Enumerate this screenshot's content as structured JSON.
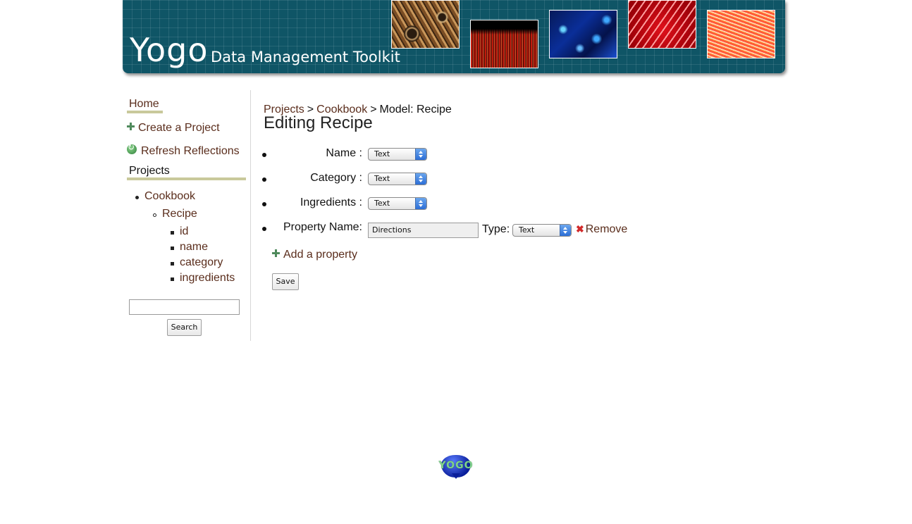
{
  "header": {
    "brand": "Yogo",
    "tagline": "Data Management Toolkit"
  },
  "sidebar": {
    "home": "Home",
    "create_project": "Create a Project",
    "refresh_reflections": "Refresh Reflections",
    "projects_heading": "Projects",
    "tree": {
      "project": "Cookbook",
      "model": "Recipe",
      "fields": [
        "id",
        "name",
        "category",
        "ingredients"
      ]
    },
    "search_value": "",
    "search_button": "Search"
  },
  "breadcrumb": {
    "projects": "Projects",
    "sep1": ">",
    "cookbook": "Cookbook",
    "sep2": ">",
    "current": "Model: Recipe"
  },
  "page_title": "Editing Recipe",
  "properties": [
    {
      "label": "Name :",
      "type": "Text"
    },
    {
      "label": "Category :",
      "type": "Text"
    },
    {
      "label": "Ingredients :",
      "type": "Text"
    }
  ],
  "new_property": {
    "name_label": "Property Name:",
    "name_value": "Directions",
    "type_label": "Type:",
    "type_value": "Text",
    "remove_label": "Remove"
  },
  "add_property": "Add a property",
  "save_button": "Save",
  "footer": {
    "logo_text": "YOGO"
  },
  "colors": {
    "banner": "#0f5566",
    "link": "#5a2d1c",
    "accent_bar": "#c9c99b",
    "plus_icon": "#4f8a5c",
    "remove_icon": "#d22a2a"
  }
}
